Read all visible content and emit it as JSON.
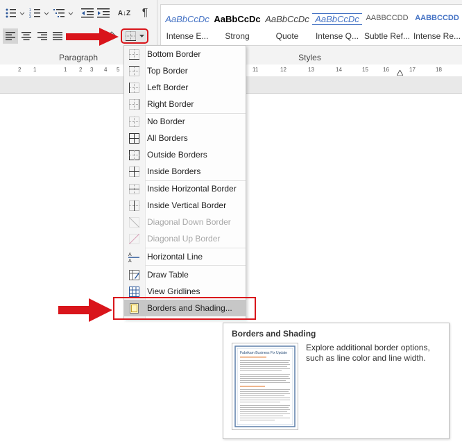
{
  "ribbon": {
    "paragraph_group_label": "Paragraph",
    "styles_group_label": "Styles",
    "pilcrow": "¶",
    "sort_label": "A↓Z",
    "styles": [
      {
        "preview": "AaBbCcDc",
        "name": "Intense E...",
        "color": "#4472c4"
      },
      {
        "preview": "AaBbCcDc",
        "name": "Strong",
        "color": "#000000"
      },
      {
        "preview": "AaBbCcDc",
        "name": "Quote",
        "color": "#404040"
      },
      {
        "preview": "AaBbCcDc",
        "name": "Intense Q...",
        "color": "#4472c4"
      },
      {
        "preview": "AABBCCDD",
        "name": "Subtle Ref...",
        "color": "#595959"
      },
      {
        "preview": "AABBCCDD",
        "name": "Intense Re...",
        "color": "#4472c4"
      }
    ]
  },
  "ruler": {
    "ticks": [
      "2",
      "1",
      "1",
      "2",
      "3",
      "4",
      "5",
      "11",
      "12",
      "13",
      "14",
      "15",
      "16",
      "17",
      "18"
    ]
  },
  "borders_menu": {
    "items": [
      {
        "label": "Bottom Border",
        "icon": "bottom-border-icon",
        "enabled": true
      },
      {
        "label": "Top Border",
        "icon": "top-border-icon",
        "enabled": true
      },
      {
        "label": "Left Border",
        "icon": "left-border-icon",
        "enabled": true
      },
      {
        "label": "Right Border",
        "icon": "right-border-icon",
        "enabled": true
      },
      {
        "label": "No Border",
        "icon": "no-border-icon",
        "enabled": true
      },
      {
        "label": "All Borders",
        "icon": "all-borders-icon",
        "enabled": true
      },
      {
        "label": "Outside Borders",
        "icon": "outside-borders-icon",
        "enabled": true
      },
      {
        "label": "Inside Borders",
        "icon": "inside-borders-icon",
        "enabled": true
      },
      {
        "label": "Inside Horizontal Border",
        "icon": "inside-horizontal-border-icon",
        "enabled": true
      },
      {
        "label": "Inside Vertical Border",
        "icon": "inside-vertical-border-icon",
        "enabled": true
      },
      {
        "label": "Diagonal Down Border",
        "icon": "diagonal-down-border-icon",
        "enabled": false
      },
      {
        "label": "Diagonal Up Border",
        "icon": "diagonal-up-border-icon",
        "enabled": false
      },
      {
        "label": "Horizontal Line",
        "icon": "horizontal-line-icon",
        "enabled": true
      },
      {
        "label": "Draw Table",
        "icon": "draw-table-icon",
        "enabled": true
      },
      {
        "label": "View Gridlines",
        "icon": "view-gridlines-icon",
        "enabled": true
      },
      {
        "label": "Borders and Shading...",
        "icon": "borders-and-shading-icon",
        "enabled": true,
        "highlighted": true
      }
    ]
  },
  "tooltip": {
    "title": "Borders and Shading",
    "description": "Explore additional border options, such as line color and line width.",
    "thumbnail_heading": "Fabrikam Business Fix Update"
  },
  "colors": {
    "annotation_red": "#d9151b",
    "accent_blue": "#4472c4"
  }
}
